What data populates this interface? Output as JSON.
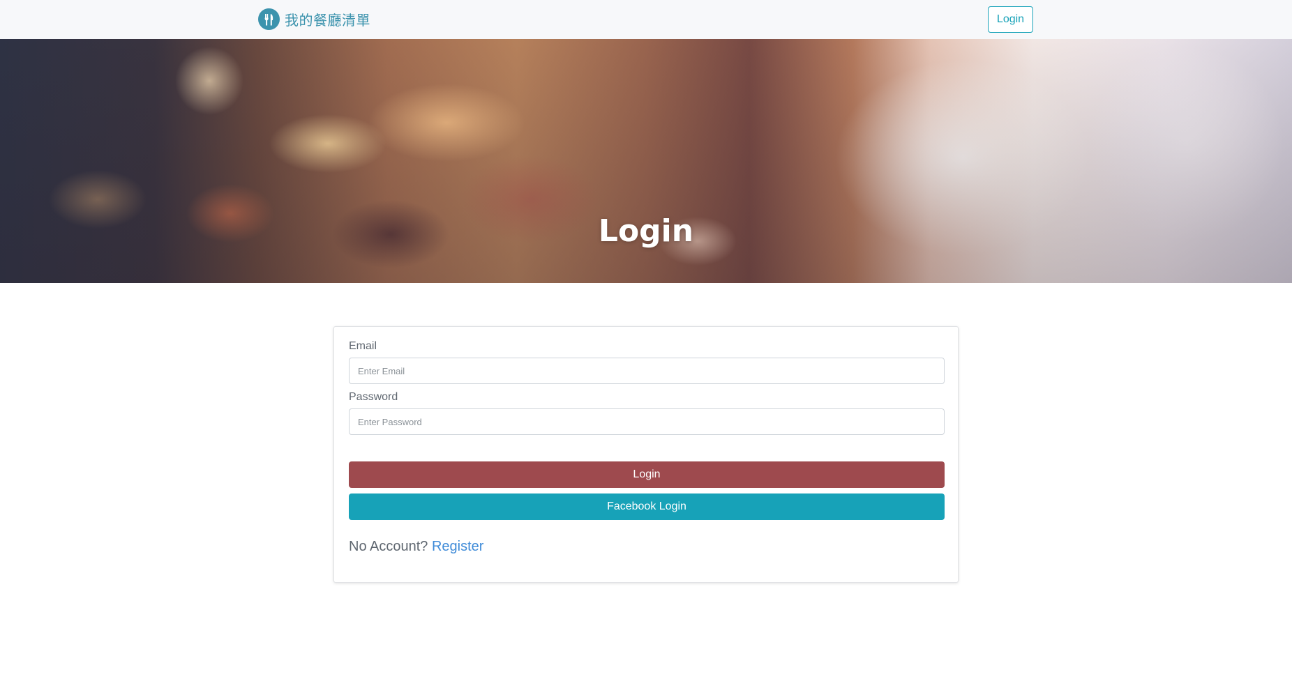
{
  "navbar": {
    "brand_name": "我的餐廳清單",
    "login_button": "Login"
  },
  "hero": {
    "title": "Login"
  },
  "form": {
    "email": {
      "label": "Email",
      "placeholder": "Enter Email",
      "value": ""
    },
    "password": {
      "label": "Password",
      "placeholder": "Enter Password",
      "value": ""
    },
    "login_button": "Login",
    "facebook_button": "Facebook Login",
    "no_account_text": "No Account?",
    "register_link": "Register"
  },
  "colors": {
    "brand": "#3c93ad",
    "nav_button": "#17a2b8",
    "login_button": "#9e4a4e",
    "facebook_button": "#17a2b8",
    "link": "#3f8bd8"
  },
  "icons": {
    "brand_logo": "fork-knife-icon"
  }
}
